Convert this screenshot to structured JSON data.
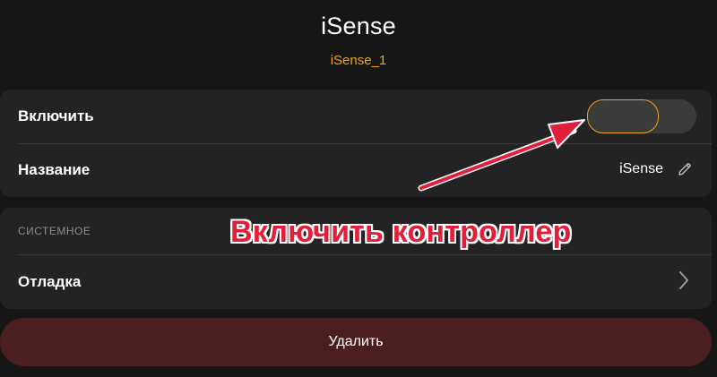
{
  "header": {
    "title": "iSense",
    "subtitle": "iSense_1"
  },
  "settings": {
    "enable": {
      "label": "Включить",
      "state": "off"
    },
    "name": {
      "label": "Название",
      "value": "iSense",
      "edit_icon": "pencil-icon"
    }
  },
  "system": {
    "section_label": "СИСТЕМНОЕ",
    "debug": {
      "label": "Отладка",
      "nav_icon": "chevron-right-icon"
    }
  },
  "actions": {
    "delete_label": "Удалить"
  },
  "annotation": {
    "text": "Включить контроллер",
    "color": "#e21f3a"
  },
  "colors": {
    "accent": "#f2a31b",
    "danger_bg": "#4b1e1f",
    "background": "#161616",
    "card": "#232323"
  }
}
